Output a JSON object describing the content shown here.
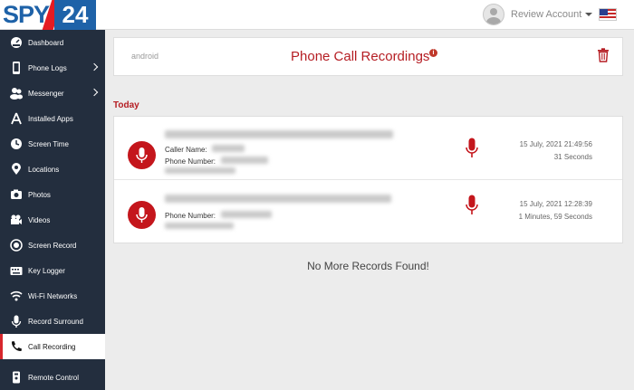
{
  "brand": {
    "logo_text_left": "SPY",
    "logo_text_right": "24"
  },
  "header": {
    "account_label": "Review Account"
  },
  "sidebar": {
    "items": [
      {
        "label": "Dashboard",
        "icon": "dashboard-icon",
        "has_submenu": false
      },
      {
        "label": "Phone Logs",
        "icon": "phone-icon",
        "has_submenu": true
      },
      {
        "label": "Messenger",
        "icon": "messenger-icon",
        "has_submenu": true
      },
      {
        "label": "Installed Apps",
        "icon": "apps-icon",
        "has_submenu": false
      },
      {
        "label": "Screen Time",
        "icon": "clock-icon",
        "has_submenu": false
      },
      {
        "label": "Locations",
        "icon": "location-pin-icon",
        "has_submenu": false
      },
      {
        "label": "Photos",
        "icon": "camera-icon",
        "has_submenu": false
      },
      {
        "label": "Videos",
        "icon": "video-camera-icon",
        "has_submenu": false
      },
      {
        "label": "Screen Record",
        "icon": "record-icon",
        "has_submenu": false
      },
      {
        "label": "Key Logger",
        "icon": "keyboard-icon",
        "has_submenu": false
      },
      {
        "label": "Wi-Fi Networks",
        "icon": "wifi-icon",
        "has_submenu": false
      },
      {
        "label": "Record Surround",
        "icon": "microphone-icon",
        "has_submenu": false
      },
      {
        "label": "Call Recording",
        "icon": "phone-handset-icon",
        "has_submenu": false,
        "active": true
      },
      {
        "label": "Remote Control",
        "icon": "remote-control-icon",
        "has_submenu": false
      }
    ]
  },
  "page": {
    "device": "android",
    "title": "Phone Call Recordings",
    "section": "Today",
    "no_more": "No More Records Found!"
  },
  "records": [
    {
      "caller_name_label": "Caller Name:",
      "phone_number_label": "Phone Number:",
      "date": "15 July, 2021 21:49:56",
      "duration": "31 Seconds"
    },
    {
      "phone_number_label": "Phone Number:",
      "date": "15 July, 2021 12:28:39",
      "duration": "1 Minutes, 59 Seconds"
    }
  ],
  "colors": {
    "accent": "#b51d23",
    "sidebar_bg": "#232e3e",
    "brand_blue": "#1e62a8"
  }
}
